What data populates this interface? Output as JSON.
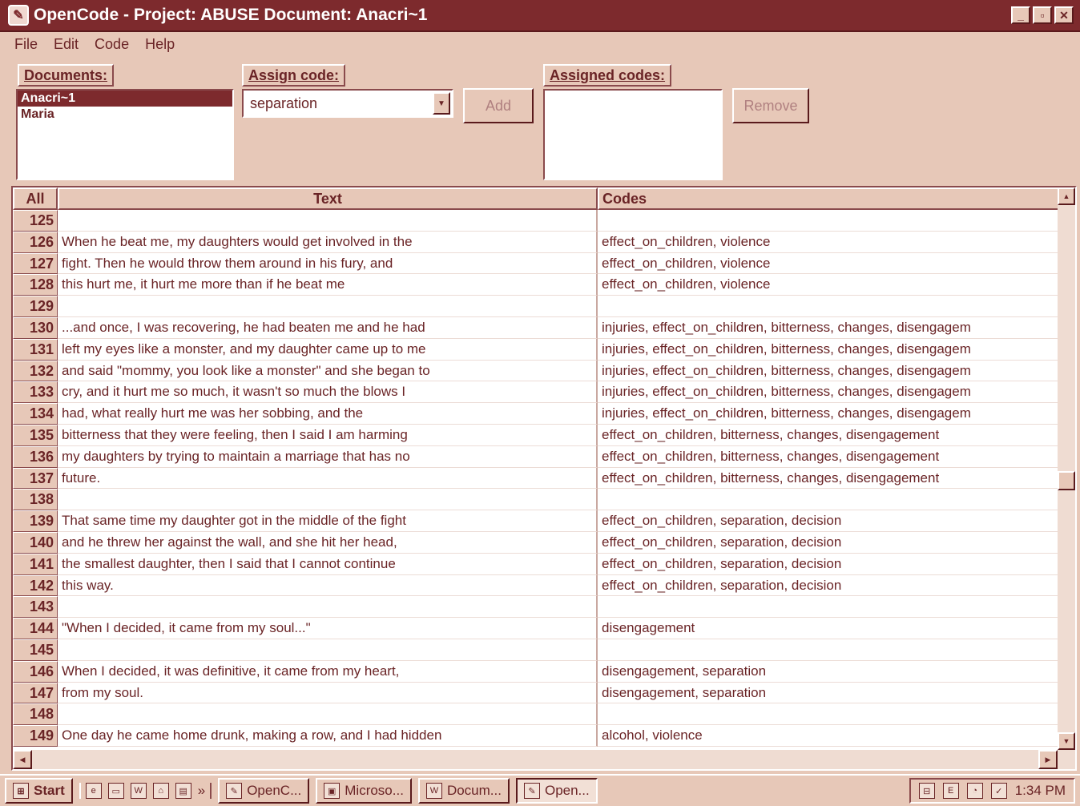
{
  "window": {
    "title": "OpenCode  -  Project: ABUSE   Document: Anacri~1"
  },
  "menu": [
    "File",
    "Edit",
    "Code",
    "Help"
  ],
  "documents": {
    "label": "Documents:",
    "items": [
      "Anacri~1",
      "Maria"
    ],
    "selected": "Anacri~1"
  },
  "assign": {
    "label": "Assign code:",
    "value": "separation",
    "add_label": "Add"
  },
  "assigned": {
    "label": "Assigned codes:",
    "remove_label": "Remove"
  },
  "grid": {
    "all_label": "All",
    "text_header": "Text",
    "codes_header": "Codes",
    "rows": [
      {
        "n": "125",
        "text": "",
        "codes": ""
      },
      {
        "n": "126",
        "text": "When he beat me, my daughters would get involved in the",
        "codes": "effect_on_children, violence"
      },
      {
        "n": "127",
        "text": "fight.  Then he would throw them around in his fury, and",
        "codes": "effect_on_children, violence"
      },
      {
        "n": "128",
        "text": "this hurt me, it hurt me more than if he beat me",
        "codes": "effect_on_children, violence"
      },
      {
        "n": "129",
        "text": "",
        "codes": ""
      },
      {
        "n": "130",
        "text": "...and once, I was recovering, he had beaten me and he had",
        "codes": "injuries, effect_on_children, bitterness, changes, disengagem"
      },
      {
        "n": "131",
        "text": "left my eyes like a monster, and my daughter came up to me",
        "codes": "injuries, effect_on_children, bitterness, changes, disengagem"
      },
      {
        "n": "132",
        "text": "and said \"mommy, you look like a monster\" and she began to",
        "codes": "injuries, effect_on_children, bitterness, changes, disengagem"
      },
      {
        "n": "133",
        "text": "cry, and it hurt me so much, it wasn't so much the blows I",
        "codes": "injuries, effect_on_children, bitterness, changes, disengagem"
      },
      {
        "n": "134",
        "text": "had, what really hurt me was her sobbing, and the",
        "codes": "injuries, effect_on_children, bitterness, changes, disengagem"
      },
      {
        "n": "135",
        "text": "bitterness that they were feeling, then I said I am harming",
        "codes": "effect_on_children, bitterness, changes, disengagement"
      },
      {
        "n": "136",
        "text": "my daughters by trying to maintain a marriage that has no",
        "codes": "effect_on_children, bitterness, changes, disengagement"
      },
      {
        "n": "137",
        "text": "future.",
        "codes": "effect_on_children, bitterness, changes, disengagement"
      },
      {
        "n": "138",
        "text": "",
        "codes": ""
      },
      {
        "n": "139",
        "text": "That same time my daughter got in the middle of the fight",
        "codes": "effect_on_children, separation, decision"
      },
      {
        "n": "140",
        "text": "and he threw her against the wall, and she hit her head,",
        "codes": "effect_on_children, separation, decision"
      },
      {
        "n": "141",
        "text": "the smallest daughter, then I said that I cannot continue",
        "codes": "effect_on_children, separation, decision"
      },
      {
        "n": "142",
        "text": "this way.",
        "codes": "effect_on_children, separation, decision"
      },
      {
        "n": "143",
        "text": "",
        "codes": ""
      },
      {
        "n": "144",
        "text": " \"When I decided,  it came from my soul...\"",
        "codes": "disengagement"
      },
      {
        "n": "145",
        "text": "",
        "codes": ""
      },
      {
        "n": "146",
        "text": "When I decided, it was definitive, it came from my heart,",
        "codes": "disengagement, separation"
      },
      {
        "n": "147",
        "text": "from my soul.",
        "codes": "disengagement, separation"
      },
      {
        "n": "148",
        "text": "",
        "codes": ""
      },
      {
        "n": "149",
        "text": "One day he came home drunk, making a row, and I had hidden",
        "codes": "alcohol, violence"
      }
    ]
  },
  "taskbar": {
    "start_label": "Start",
    "chevron": "»",
    "tasks": [
      "OpenC...",
      "Microso...",
      "Docum...",
      "Open..."
    ],
    "active_task": "Open...",
    "clock": "1:34 PM"
  }
}
